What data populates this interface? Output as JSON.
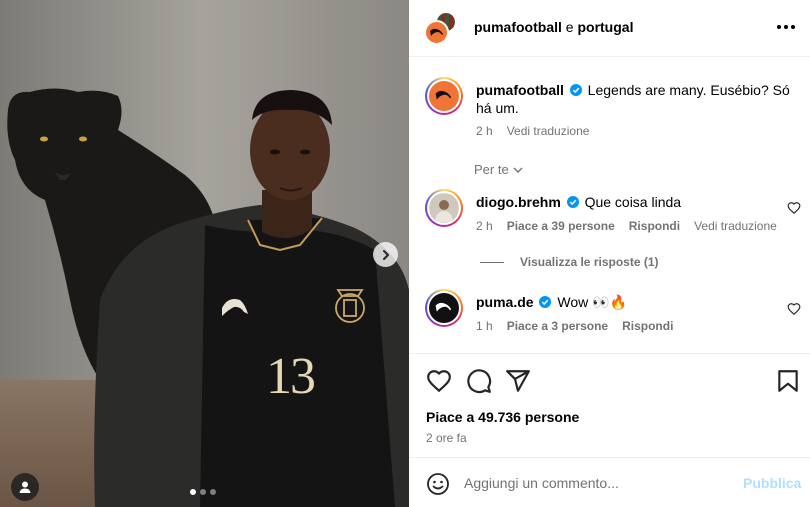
{
  "post": {
    "header": {
      "username": "pumafootball",
      "connector": "e",
      "collaborator": "portugal"
    },
    "caption": {
      "username": "pumafootball",
      "text": "Legends are many. Eusébio? Só há um.",
      "age": "2 h",
      "translate": "Vedi traduzione"
    },
    "sort_label": "Per te",
    "comments": [
      {
        "username": "diogo.brehm",
        "text": "Que coisa linda",
        "age": "2 h",
        "likes": "Piace a 39 persone",
        "reply": "Rispondi",
        "translate": "Vedi traduzione"
      },
      {
        "username": "puma.de",
        "text": "Wow 👀🔥",
        "age": "1 h",
        "likes": "Piace a 3 persone",
        "reply": "Rispondi"
      }
    ],
    "view_replies": "Visualizza le risposte (1)",
    "like_count": "Piace a 49.736 persone",
    "posted_ago": "2 ore fa",
    "composer": {
      "placeholder": "Aggiungi un commento...",
      "publish": "Pubblica"
    },
    "jersey_number": "13",
    "carousel": {
      "current": 1,
      "total": 3
    }
  },
  "colors": {
    "accent_disabled": "#b2dffc",
    "muted": "#737373",
    "verified": "#0095f6"
  },
  "icons": [
    "more-icon",
    "verified-icon",
    "heart-icon",
    "comment-icon",
    "share-icon",
    "bookmark-icon",
    "emoji-icon",
    "chevron-right-icon",
    "chevron-down-icon",
    "user-tag-icon",
    "puma-logo-icon"
  ]
}
